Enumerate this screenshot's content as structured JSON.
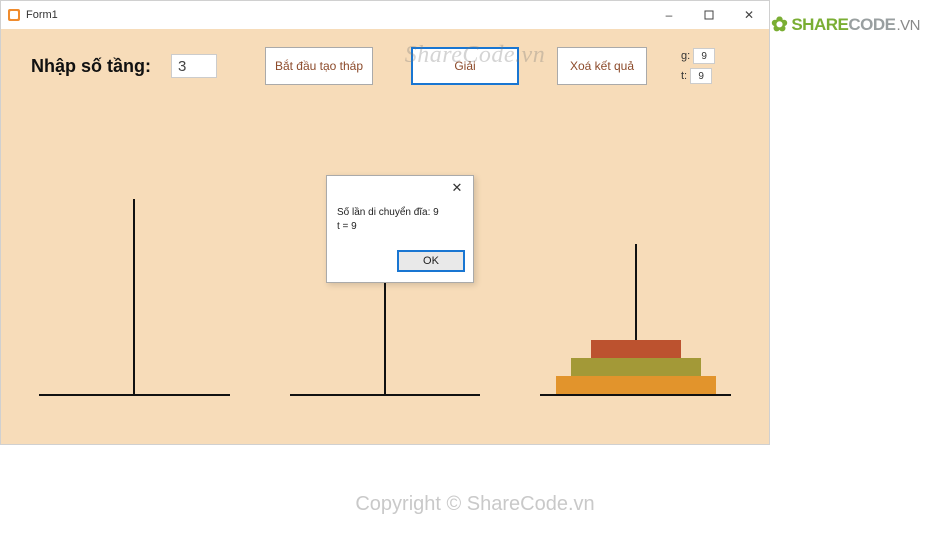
{
  "window": {
    "title": "Form1"
  },
  "inputs": {
    "label": "Nhập số tầng:",
    "value": "3"
  },
  "buttons": {
    "create": "Bắt đầu tạo tháp",
    "solve": "Giải",
    "clear": "Xoá kết quả"
  },
  "side": {
    "g_label": "g:",
    "g_value": "9",
    "t_label": "t:",
    "t_value": "9"
  },
  "msgbox": {
    "line1": "Số lần di chuyển đĩa: 9",
    "line2": "t = 9",
    "ok": "OK"
  },
  "watermark": {
    "text": "ShareCode.vn",
    "logo_share": "SHARE",
    "logo_code": "CODE",
    "logo_vn": ".VN"
  },
  "footer": {
    "copyright": "Copyright © ShareCode.vn"
  }
}
